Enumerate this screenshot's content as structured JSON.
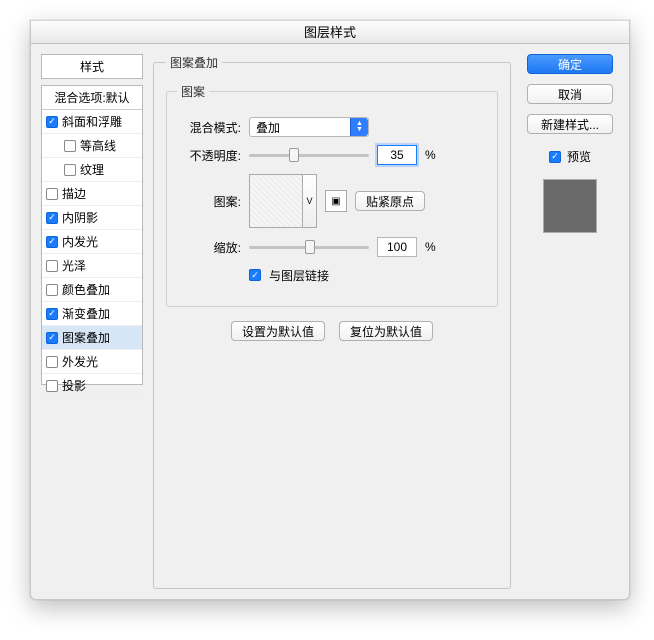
{
  "title": "图层样式",
  "sidebar": {
    "styles_label": "样式",
    "blend_header": "混合选项:默认",
    "items": [
      {
        "label": "斜面和浮雕",
        "checked": true,
        "indent": false
      },
      {
        "label": "等高线",
        "checked": false,
        "indent": true
      },
      {
        "label": "纹理",
        "checked": false,
        "indent": true
      },
      {
        "label": "描边",
        "checked": false,
        "indent": false
      },
      {
        "label": "内阴影",
        "checked": true,
        "indent": false
      },
      {
        "label": "内发光",
        "checked": true,
        "indent": false
      },
      {
        "label": "光泽",
        "checked": false,
        "indent": false
      },
      {
        "label": "颜色叠加",
        "checked": false,
        "indent": false
      },
      {
        "label": "渐变叠加",
        "checked": true,
        "indent": false
      },
      {
        "label": "图案叠加",
        "checked": true,
        "indent": false,
        "selected": true
      },
      {
        "label": "外发光",
        "checked": false,
        "indent": false
      },
      {
        "label": "投影",
        "checked": false,
        "indent": false
      }
    ]
  },
  "panel": {
    "outer_legend": "图案叠加",
    "inner_legend": "图案",
    "blend_mode_label": "混合模式:",
    "blend_mode_value": "叠加",
    "opacity_label": "不透明度:",
    "opacity_value": "35",
    "opacity_pct": "%",
    "pattern_label": "图案:",
    "snap_origin_btn": "贴紧原点",
    "scale_label": "缩放:",
    "scale_value": "100",
    "scale_pct": "%",
    "link_layer_label": "与图层链接",
    "link_layer_checked": true,
    "set_default_btn": "设置为默认值",
    "reset_default_btn": "复位为默认值"
  },
  "right": {
    "ok": "确定",
    "cancel": "取消",
    "new_style": "新建样式...",
    "preview_label": "预览",
    "preview_checked": true
  }
}
